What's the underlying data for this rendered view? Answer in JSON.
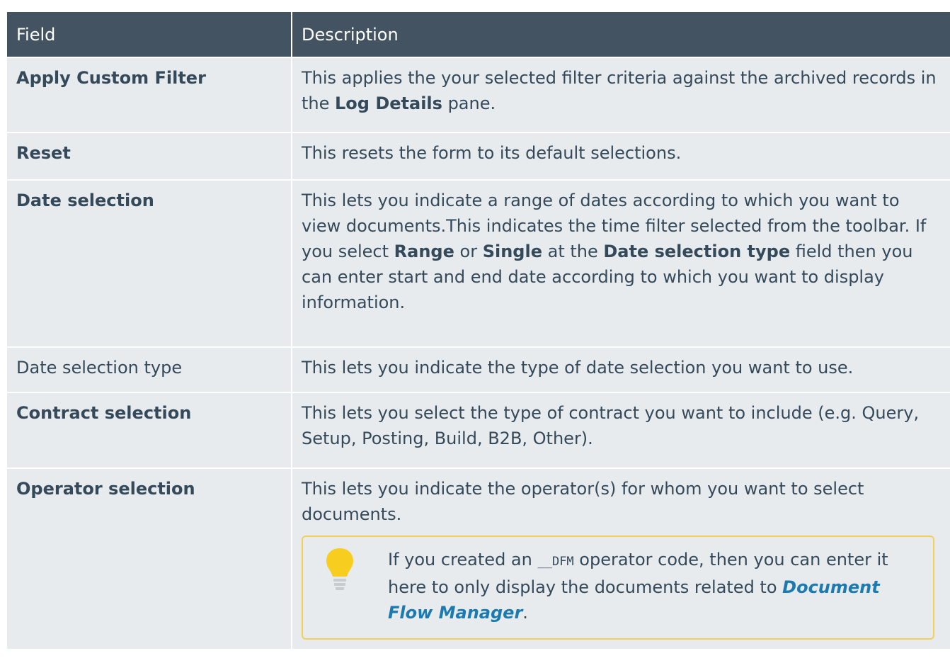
{
  "table": {
    "headers": {
      "field": "Field",
      "description": "Description"
    },
    "rows": {
      "apply": {
        "field": "Apply Custom Filter",
        "desc_1": "This applies the your selected filter criteria against the archived records in the ",
        "desc_2": "Log Details",
        "desc_3": " pane."
      },
      "reset": {
        "field": "Reset",
        "desc": "This resets the form to its default selections."
      },
      "date_selection": {
        "field": "Date selection",
        "desc_1": "This lets you indicate a range of dates according to which you want to view documents.This indicates the time filter selected from the toolbar. If you select ",
        "desc_2": "Range",
        "desc_3": " or ",
        "desc_4": "Single",
        "desc_5": " at the ",
        "desc_6": "Date selection type",
        "desc_7": " field then you can enter start and end date according to which you want to display information."
      },
      "date_selection_type": {
        "field": "Date selection type",
        "desc": "This lets you indicate the type of date selection you want to use."
      },
      "contract_selection": {
        "field": "Contract selection",
        "desc": "This lets you select the type of contract you want to include (e.g. Query, Setup, Posting, Build, B2B, Other)."
      },
      "operator_selection": {
        "field": "Operator selection",
        "desc": "This lets you indicate the operator(s) for whom you want to select documents.",
        "note": {
          "text_1": "If you created an ",
          "code": "__DFM",
          "text_2": " operator code, then you can enter it here to only display the documents related to ",
          "link": "Document Flow Manager",
          "text_3": "."
        }
      }
    }
  },
  "colors": {
    "header_bg": "#435362",
    "row_bg": "#e8ebee",
    "text": "#34495a",
    "note_border": "#f1d05a",
    "bulb": "#f7cd1f",
    "link": "#1b7bb0"
  },
  "icons": {
    "note": "lightbulb-icon"
  }
}
